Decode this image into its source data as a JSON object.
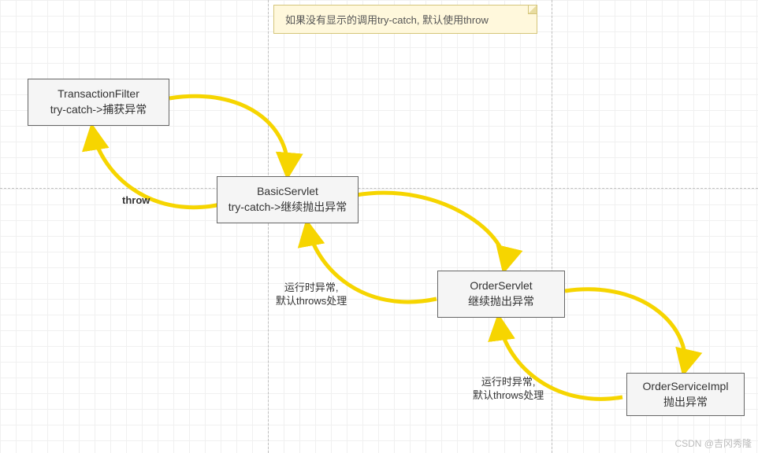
{
  "note": {
    "text": "如果没有显示的调用try-catch, 默认使用throw"
  },
  "nodes": {
    "transactionFilter": {
      "title": "TransactionFilter",
      "subtitle": "try-catch->捕获异常"
    },
    "basicServlet": {
      "title": "BasicServlet",
      "subtitle": "try-catch->继续抛出异常"
    },
    "orderServlet": {
      "title": "OrderServlet",
      "subtitle": "继续抛出异常"
    },
    "orderServiceImpl": {
      "title": "OrderServiceImpl",
      "subtitle": "抛出异常"
    }
  },
  "edges": {
    "throw": "throw",
    "runtime1": {
      "line1": "运行时异常,",
      "line2": "默认throws处理"
    },
    "runtime2": {
      "line1": "运行时异常,",
      "line2": "默认throws处理"
    }
  },
  "watermark": "CSDN @吉冈秀隆",
  "chart_data": {
    "type": "diagram",
    "title": "",
    "nodes": [
      {
        "id": "TransactionFilter",
        "label": "TransactionFilter\ntry-catch->捕获异常"
      },
      {
        "id": "BasicServlet",
        "label": "BasicServlet\ntry-catch->继续抛出异常"
      },
      {
        "id": "OrderServlet",
        "label": "OrderServlet\n继续抛出异常"
      },
      {
        "id": "OrderServiceImpl",
        "label": "OrderServiceImpl\n抛出异常"
      }
    ],
    "edges_forward": [
      {
        "from": "TransactionFilter",
        "to": "BasicServlet"
      },
      {
        "from": "BasicServlet",
        "to": "OrderServlet"
      },
      {
        "from": "OrderServlet",
        "to": "OrderServiceImpl"
      }
    ],
    "edges_back": [
      {
        "from": "OrderServiceImpl",
        "to": "OrderServlet",
        "label": "运行时异常, 默认throws处理"
      },
      {
        "from": "OrderServlet",
        "to": "BasicServlet",
        "label": "运行时异常, 默认throws处理"
      },
      {
        "from": "BasicServlet",
        "to": "TransactionFilter",
        "label": "throw"
      }
    ],
    "note": "如果没有显示的调用try-catch, 默认使用throw"
  }
}
